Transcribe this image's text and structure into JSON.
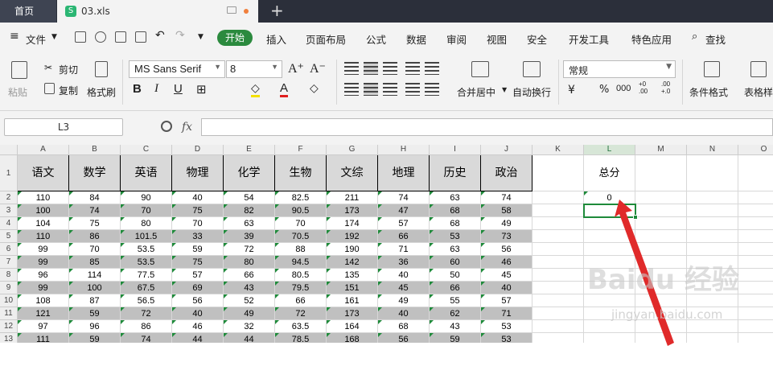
{
  "tabs": {
    "home": "首页",
    "file": "03.xls",
    "file_icon": "S"
  },
  "menu": {
    "file": "文件",
    "active": "开始",
    "items": [
      "插入",
      "页面布局",
      "公式",
      "数据",
      "审阅",
      "视图",
      "安全",
      "开发工具",
      "特色应用"
    ],
    "search": "查找"
  },
  "toolbar": {
    "paste": "粘贴",
    "cut": "剪切",
    "copy": "复制",
    "format_painter": "格式刷",
    "font": "MS Sans Serif",
    "size": "8",
    "merge": "合并居中",
    "wrap": "自动换行",
    "number_format": "常规",
    "percent": "%",
    "thousands": "000",
    "cond_format": "条件格式",
    "table_style": "表格样"
  },
  "formula": {
    "cell_ref": "L3",
    "fx": "fx",
    "value": ""
  },
  "sheet": {
    "columns": [
      "A",
      "B",
      "C",
      "D",
      "E",
      "F",
      "G",
      "H",
      "I",
      "J",
      "K",
      "L",
      "M",
      "N",
      "O"
    ],
    "selected_col": "L",
    "row_numbers": [
      "1",
      "2",
      "3",
      "4",
      "5",
      "6",
      "7",
      "8",
      "9",
      "10",
      "11",
      "12",
      "13"
    ],
    "headers": [
      "语文",
      "数学",
      "英语",
      "物理",
      "化学",
      "生物",
      "文综",
      "地理",
      "历史",
      "政治"
    ],
    "total_header": "总分",
    "total_value": "0",
    "rows": [
      [
        "110",
        "84",
        "90",
        "40",
        "54",
        "82.5",
        "211",
        "74",
        "63",
        "74"
      ],
      [
        "100",
        "74",
        "70",
        "75",
        "82",
        "90.5",
        "173",
        "47",
        "68",
        "58"
      ],
      [
        "104",
        "75",
        "80",
        "70",
        "63",
        "70",
        "174",
        "57",
        "68",
        "49"
      ],
      [
        "110",
        "86",
        "101.5",
        "33",
        "39",
        "70.5",
        "192",
        "66",
        "53",
        "73"
      ],
      [
        "99",
        "70",
        "53.5",
        "59",
        "72",
        "88",
        "190",
        "71",
        "63",
        "56"
      ],
      [
        "99",
        "85",
        "53.5",
        "75",
        "80",
        "94.5",
        "142",
        "36",
        "60",
        "46"
      ],
      [
        "96",
        "114",
        "77.5",
        "57",
        "66",
        "80.5",
        "135",
        "40",
        "50",
        "45"
      ],
      [
        "99",
        "100",
        "67.5",
        "69",
        "43",
        "79.5",
        "151",
        "45",
        "66",
        "40"
      ],
      [
        "108",
        "87",
        "56.5",
        "56",
        "52",
        "66",
        "161",
        "49",
        "55",
        "57"
      ],
      [
        "121",
        "59",
        "72",
        "40",
        "49",
        "72",
        "173",
        "40",
        "62",
        "71"
      ],
      [
        "97",
        "96",
        "86",
        "46",
        "32",
        "63.5",
        "164",
        "68",
        "43",
        "53"
      ],
      [
        "111",
        "59",
        "74",
        "44",
        "44",
        "78.5",
        "168",
        "56",
        "59",
        "53"
      ]
    ]
  },
  "watermark": {
    "brand": "Baidu 经验",
    "url": "jingyan.baidu.com"
  }
}
